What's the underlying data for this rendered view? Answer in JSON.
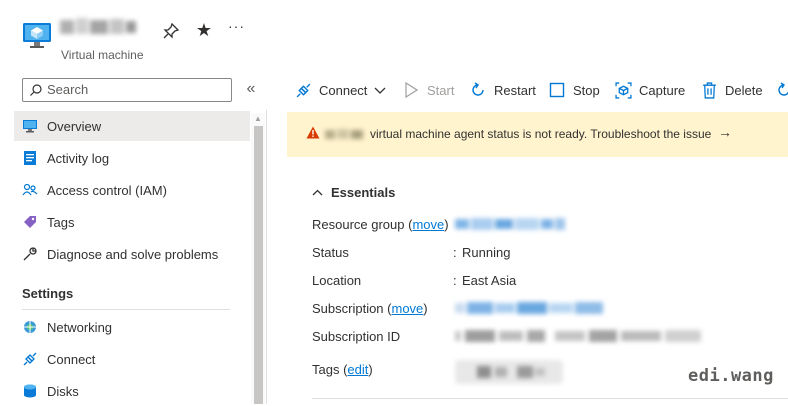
{
  "header": {
    "resource_name": "",
    "subtitle": "Virtual machine",
    "more_label": "···"
  },
  "sidebar": {
    "search_placeholder": "Search",
    "collapse_label": "«",
    "items": [
      {
        "label": "Overview",
        "icon": "monitor-icon"
      },
      {
        "label": "Activity log",
        "icon": "activity-log-icon"
      },
      {
        "label": "Access control (IAM)",
        "icon": "people-icon"
      },
      {
        "label": "Tags",
        "icon": "tag-icon"
      },
      {
        "label": "Diagnose and solve problems",
        "icon": "wrench-icon"
      }
    ],
    "settings_section": "Settings",
    "settings_items": [
      {
        "label": "Networking",
        "icon": "network-icon"
      },
      {
        "label": "Connect",
        "icon": "connect-icon"
      },
      {
        "label": "Disks",
        "icon": "disks-icon"
      }
    ]
  },
  "toolbar": {
    "connect": "Connect",
    "start": "Start",
    "restart": "Restart",
    "stop": "Stop",
    "capture": "Capture",
    "delete": "Delete"
  },
  "banner": {
    "message": "virtual machine agent status is not ready. Troubleshoot the issue",
    "arrow": "→"
  },
  "essentials": {
    "title": "Essentials",
    "chevron": "∧",
    "resource_group_label": "Resource group",
    "subscription_label": "Subscription",
    "move_link": "move",
    "edit_link": "edit",
    "status_label": "Status",
    "status_value": "Running",
    "location_label": "Location",
    "location_value": "East Asia",
    "subscription_id_label": "Subscription ID",
    "tags_label": "Tags",
    "colon": ":"
  },
  "watermark": "edi.wang",
  "colors": {
    "accent": "#0078d4",
    "banner_bg": "#fff4ce",
    "warning": "#d83b01",
    "active_bg": "#edebe9"
  }
}
